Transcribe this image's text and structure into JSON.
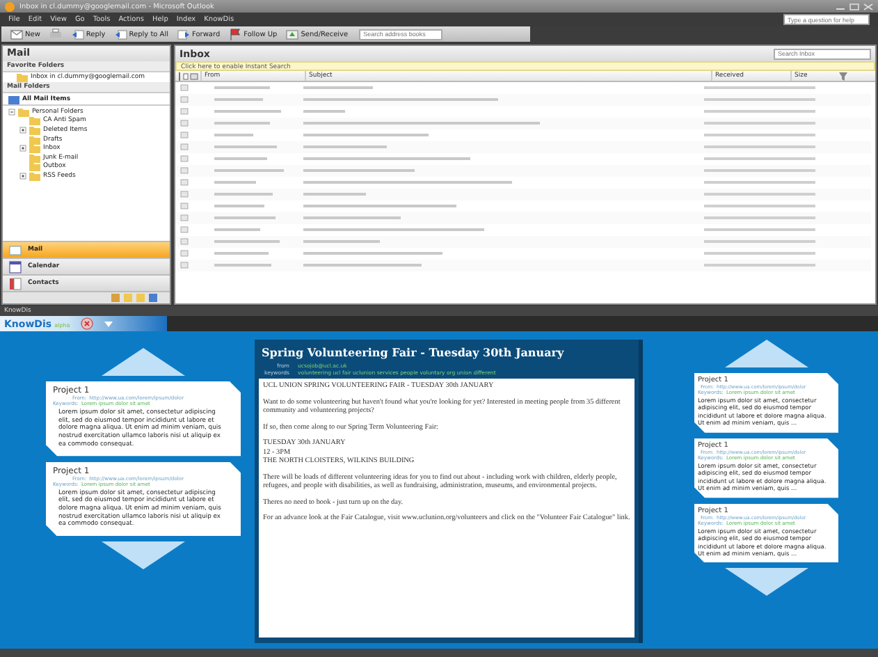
{
  "window": {
    "title": "Inbox in cl.dummy@googlemail.com - Microsoft Outlook"
  },
  "menu": [
    "File",
    "Edit",
    "View",
    "Go",
    "Tools",
    "Actions",
    "Help",
    "Index",
    "KnowDis"
  ],
  "help_box": {
    "placeholder": "Type a question for help"
  },
  "toolbar": [
    {
      "label": "New",
      "kind": "new"
    },
    {
      "kind": "print"
    },
    {
      "label": "Reply",
      "kind": "reply"
    },
    {
      "label": "Reply to All",
      "kind": "replyall"
    },
    {
      "label": "Forward",
      "kind": "forward"
    },
    {
      "label": "Follow Up",
      "kind": "flag"
    },
    {
      "label": "Send/Receive",
      "kind": "send"
    }
  ],
  "address_search": {
    "placeholder": "Search address books"
  },
  "nav": {
    "title": "Mail",
    "favorites_label": "Favorite Folders",
    "favorites": [
      "Inbox in cl.dummy@googlemail.com"
    ],
    "folders_label": "Mail Folders",
    "all_items": "All Mail Items",
    "tree": [
      {
        "label": "Personal Folders",
        "expandable": true,
        "expanded": true,
        "children": [
          {
            "label": "CA Anti Spam",
            "expandable": false,
            "expanded": false
          },
          {
            "label": "Deleted Items",
            "expandable": true,
            "expanded": false
          },
          {
            "label": "Drafts",
            "expandable": false,
            "expanded": false
          },
          {
            "label": "Inbox",
            "expandable": true,
            "expanded": false
          },
          {
            "label": "Junk E-mail",
            "expandable": false,
            "expanded": false
          },
          {
            "label": "Outbox",
            "expandable": false,
            "expanded": false
          },
          {
            "label": "RSS Feeds",
            "expandable": true,
            "expanded": false
          }
        ]
      }
    ],
    "buttons": [
      {
        "label": "Mail",
        "selected": true
      },
      {
        "label": "Calendar",
        "selected": false
      },
      {
        "label": "Contacts",
        "selected": false
      }
    ]
  },
  "inbox": {
    "title": "Inbox",
    "search": {
      "placeholder": "Search Inbox"
    },
    "instant_search": "Click here to enable Instant Search",
    "columns": [
      "From",
      "Subject",
      "Received",
      "Size"
    ]
  },
  "knowdis": {
    "title": "KnowDis",
    "logo": "KnowDis",
    "logo_tag": "alpha",
    "left_cards": [
      {
        "title": "Project 1",
        "from_label": "From:",
        "from": "http://www.ua.com/lorem/ipsum/dolor",
        "keywords_label": "Keywords:",
        "keywords": "Lorem ipsum dolor sit amet",
        "body": "Lorem ipsum dolor sit amet, consectetur adipiscing elit, sed do eiusmod tempor incididunt ut labore et dolore magna aliqua. Ut enim ad minim veniam, quis nostrud exercitation ullamco laboris nisi ut aliquip ex ea commodo consequat."
      },
      {
        "title": "Project 1",
        "from_label": "From:",
        "from": "http://www.ua.com/lorem/ipsum/dolor",
        "keywords_label": "Keywords:",
        "keywords": "Lorem ipsum dolor sit amet",
        "body": "Lorem ipsum dolor sit amet, consectetur adipiscing elit, sed do eiusmod tempor incididunt ut labore et dolore magna aliqua. Ut enim ad minim veniam, quis nostrud exercitation ullamco laboris nisi ut aliquip ex ea commodo consequat."
      }
    ],
    "main_card": {
      "title": "Spring Volunteering Fair - Tuesday 30th January",
      "from_label": "from",
      "from": "ucsojob@ucl.ac.uk",
      "keywords_label": "keywords",
      "keywords": "volunteering ucl fair uclunion services people voluntary org union different",
      "paragraphs": [
        "UCL UNION SPRING VOLUNTEERING FAIR - TUESDAY 30th JANUARY",
        "Want to do some volunteering but haven't found what you're looking for yet? Interested in meeting people from 35 different community and volunteering projects?",
        "If so, then come along to our Spring Term Volunteering Fair:",
        "TUESDAY 30th JANUARY\n12 - 3PM\nTHE NORTH CLOISTERS, WILKINS BUILDING",
        "There will be loads of different volunteering ideas for you to find out about - including work with children, elderly people, refugees, and people with disabilities, as well as fundraising, administration, museums, and environmental projects.",
        "Theres no need to book - just turn up on the day.",
        "For an advance look at the Fair Catalogue, visit www.uclunion.org/volunteers and click on the \"Volunteer Fair Catalogue\" link."
      ]
    },
    "right_cards": [
      {
        "title": "Project 1",
        "from_label": "From:",
        "from": "http://www.ua.com/lorem/ipsum/dolor",
        "keywords_label": "Keywords:",
        "keywords": "Lorem ipsum dolor sit amet",
        "body": "Lorem ipsum dolor sit amet, consectetur adipiscing elit, sed do eiusmod tempor incididunt ut labore et dolore magna aliqua. Ut enim ad minim veniam, quis ..."
      },
      {
        "title": "Project 1",
        "from_label": "From:",
        "from": "http://www.ua.com/lorem/ipsum/dolor",
        "keywords_label": "Keywords:",
        "keywords": "Lorem ipsum dolor sit amet",
        "body": "Lorem ipsum dolor sit amet, consectetur adipiscing elit, sed do eiusmod tempor incididunt ut labore et dolore magna aliqua. Ut enim ad minim veniam, quis ..."
      },
      {
        "title": "Project 1",
        "from_label": "From:",
        "from": "http://www.ua.com/lorem/ipsum/dolor",
        "keywords_label": "Keywords:",
        "keywords": "Lorem ipsum dolor sit amet",
        "body": "Lorem ipsum dolor sit amet, consectetur adipiscing elit, sed do eiusmod tempor incididunt ut labore et dolore magna aliqua. Ut enim ad minim veniam, quis ..."
      }
    ]
  }
}
